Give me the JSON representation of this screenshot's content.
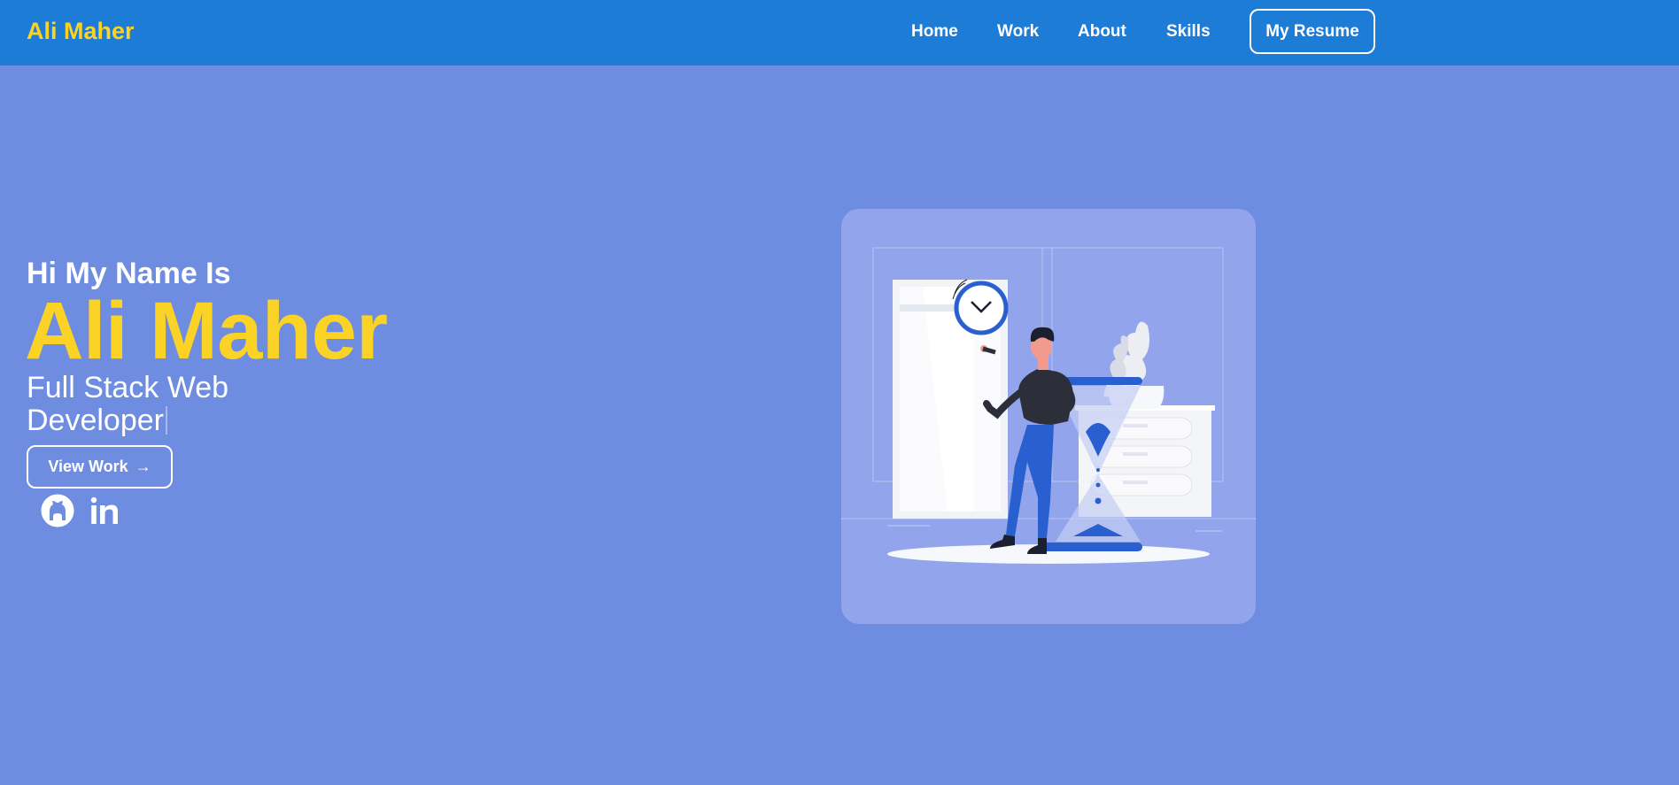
{
  "header": {
    "brand": "Ali Maher",
    "nav": [
      "Home",
      "Work",
      "About",
      "Skills"
    ],
    "resume_label": "My Resume"
  },
  "hero": {
    "greeting": "Hi My Name Is",
    "name": "Ali Maher",
    "role": "Full Stack Web Developer",
    "cta_label": "View Work",
    "cta_arrow": "→"
  },
  "social": [
    "github-icon",
    "linkedin-icon"
  ],
  "colors": {
    "navbar": "#1c7cd6",
    "background": "#6f8de0",
    "accent": "#fbd327",
    "illustration_bg": "#92a4ec",
    "illustration_blue": "#2a5fcf"
  }
}
